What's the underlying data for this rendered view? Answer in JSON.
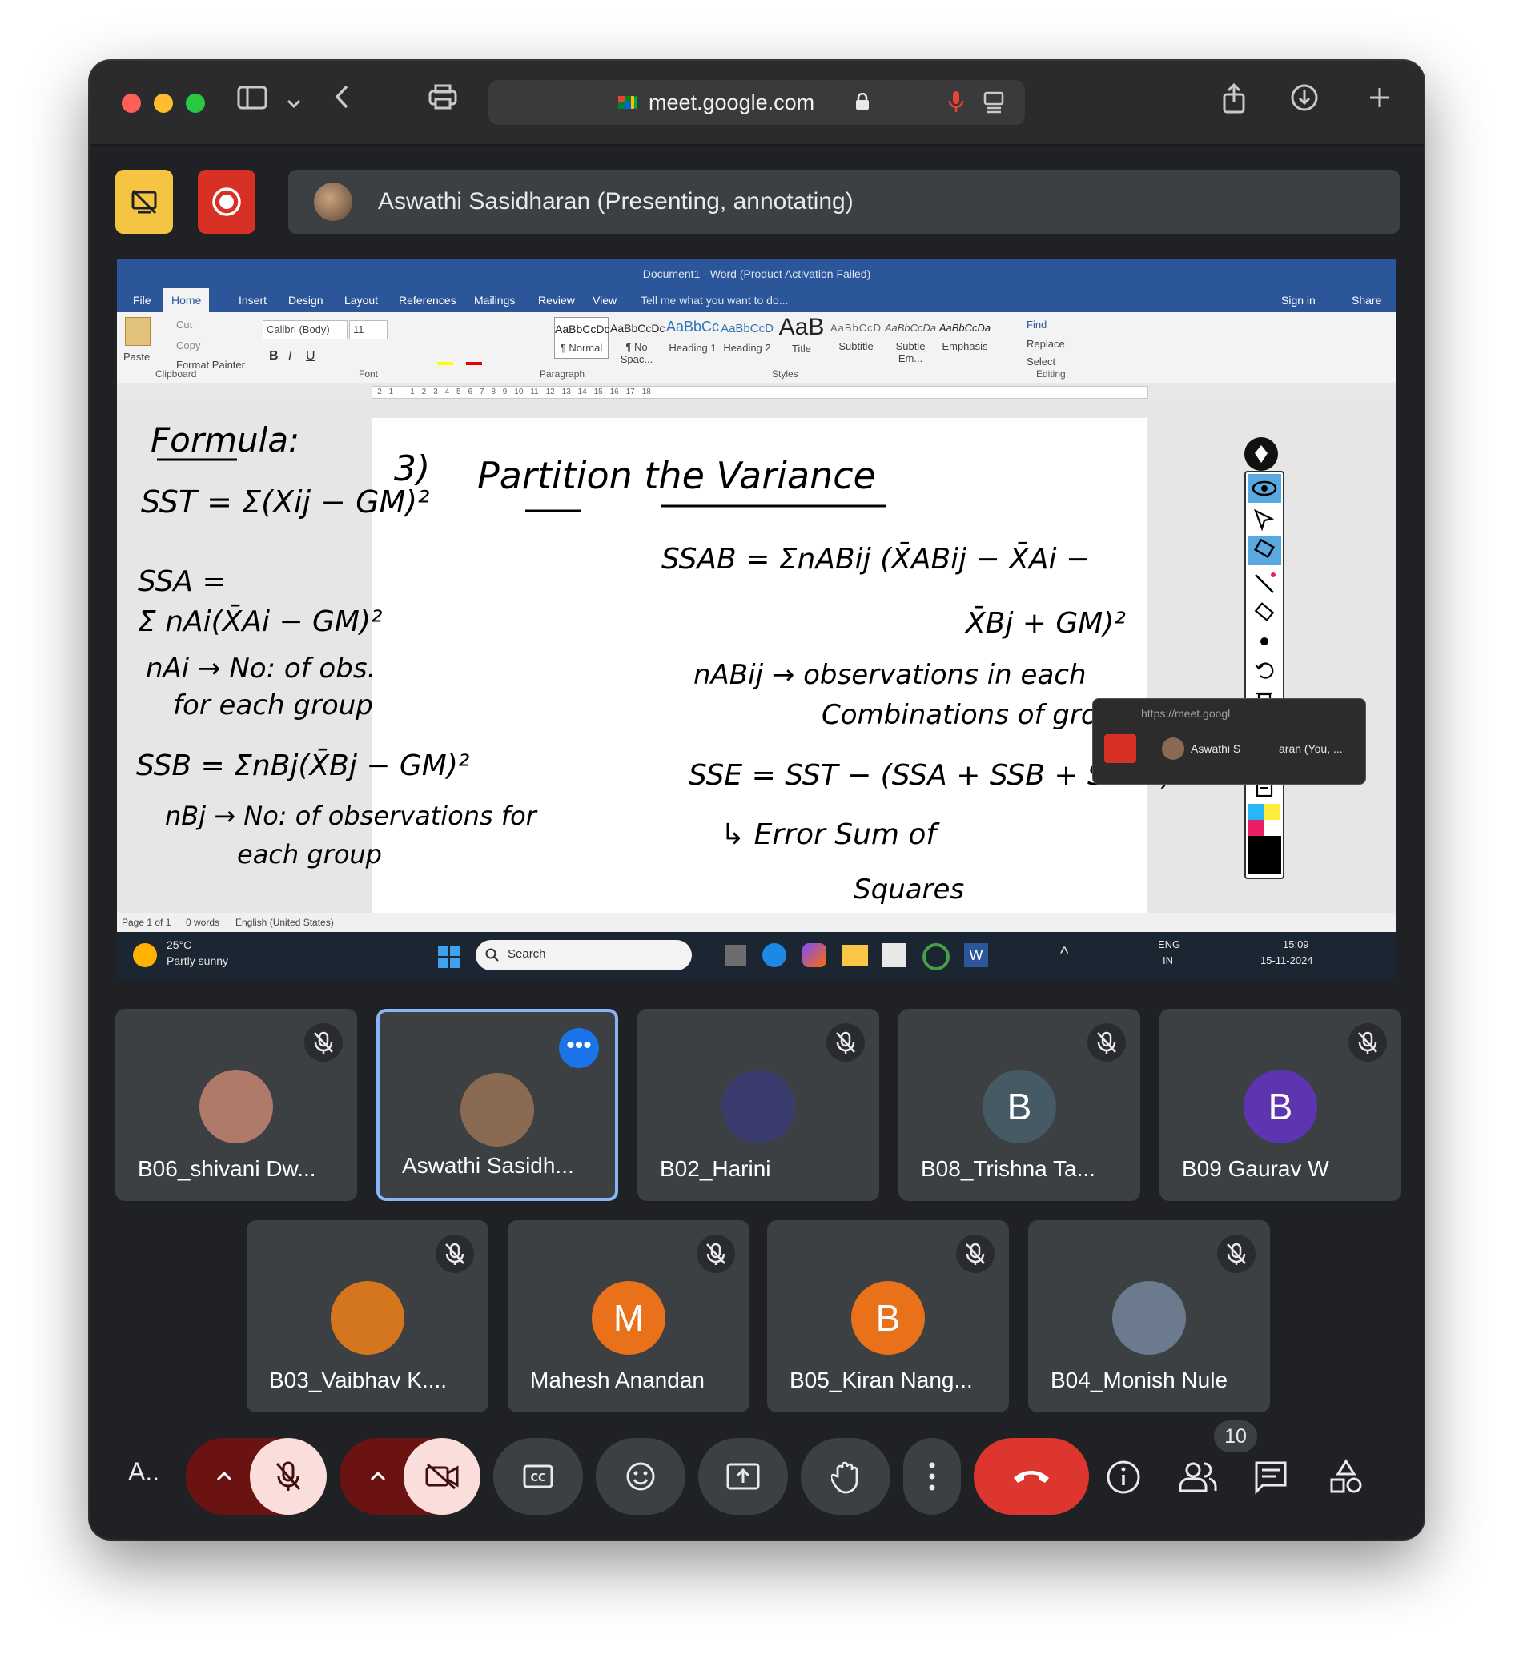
{
  "browser": {
    "url": "meet.google.com"
  },
  "meet": {
    "presenter_banner": "Aswathi Sasidharan (Presenting, annotating)"
  },
  "word": {
    "title": "Document1 - Word (Product Activation Failed)",
    "tabs": [
      "File",
      "Home",
      "Insert",
      "Design",
      "Layout",
      "References",
      "Mailings",
      "Review",
      "View"
    ],
    "tell_me": "Tell me what you want to do...",
    "sign_in": "Sign in",
    "share": "Share",
    "clipboard": {
      "paste": "Paste",
      "cut": "Cut",
      "copy": "Copy",
      "format_painter": "Format Painter",
      "group": "Clipboard"
    },
    "font": {
      "name": "Calibri (Body)",
      "size": "11",
      "group": "Font"
    },
    "paragraph_group": "Paragraph",
    "styles": [
      {
        "preview": "AaBbCcDc",
        "label": "¶ Normal"
      },
      {
        "preview": "AaBbCcDc",
        "label": "¶ No Spac..."
      },
      {
        "preview": "AaBbCc",
        "label": "Heading 1"
      },
      {
        "preview": "AaBbCcD",
        "label": "Heading 2"
      },
      {
        "preview": "AaB",
        "label": "Title"
      },
      {
        "preview": "AaBbCcD",
        "label": "Subtitle"
      },
      {
        "preview": "AaBbCcDa",
        "label": "Subtle Em..."
      },
      {
        "preview": "AaBbCcDa",
        "label": "Emphasis"
      }
    ],
    "styles_group": "Styles",
    "editing": {
      "find": "Find",
      "replace": "Replace",
      "select": "Select",
      "group": "Editing"
    },
    "ruler_marks": "· 2 · 1 · · · 1 · 2 · 3 · 4 · 5 · 6 · 7 · 8 · 9 · 10 · 11 · 12 · 13 · 14 · 15 · 16 · 17 · 18 ·",
    "status": {
      "page": "Page 1 of 1",
      "words": "0 words",
      "language": "English (United States)"
    }
  },
  "annotations": {
    "left": [
      "Formula:",
      "SST = Σ(Xij − GM)²",
      "SSA =",
      "Σ nAi(X̄Ai − GM)²",
      "nAi → No: of obs.",
      "for each group",
      "SSB = ΣnBj(X̄Bj − GM)²",
      "nBj → No: of observations for",
      "each group"
    ],
    "right": [
      "3)",
      "Partition the Variance",
      "SSAB = ΣnABij (X̄ABij − X̄Ai −",
      "X̄Bj + GM)²",
      "nABij → observations in each",
      "Combinations of groups",
      "SSE = SST − (SSA + SSB + SSAB)",
      "↳ Error Sum of",
      "Squares"
    ]
  },
  "mini_share": {
    "url": "https://meet.googl",
    "name": "Aswathi S",
    "name_suffix": "aran (You, ..."
  },
  "taskbar": {
    "weather_temp": "25°C",
    "weather_desc": "Partly sunny",
    "search": "Search",
    "lang_top": "ENG",
    "lang_bottom": "IN",
    "time": "15:09",
    "date": "15-11-2024"
  },
  "participants": [
    {
      "name": "B06_shivani Dw...",
      "initial": "",
      "color": "#b07a6a",
      "selected": false
    },
    {
      "name": "Aswathi Sasidh...",
      "initial": "",
      "color": "#8a6a52",
      "selected": true
    },
    {
      "name": "B02_Harini",
      "initial": "",
      "color": "#3b3c6e",
      "selected": false
    },
    {
      "name": "B08_Trishna Ta...",
      "initial": "B",
      "color": "#455a64",
      "selected": false
    },
    {
      "name": "B09 Gaurav W",
      "initial": "B",
      "color": "#5e35b1",
      "selected": false
    },
    {
      "name": "B03_Vaibhav K....",
      "initial": "",
      "color": "#d4761e",
      "selected": false
    },
    {
      "name": "Mahesh Anandan",
      "initial": "M",
      "color": "#e8711a",
      "selected": false
    },
    {
      "name": "B05_Kiran Nang...",
      "initial": "B",
      "color": "#e8711a",
      "selected": false
    },
    {
      "name": "B04_Monish Nule",
      "initial": "",
      "color": "#6b7a8c",
      "selected": false
    }
  ],
  "controls": {
    "self_label": "A..",
    "people_count": "10"
  },
  "colors": {
    "meet_bg": "#202124",
    "tile_bg": "#3c4043",
    "end_call": "#d93025",
    "word_blue": "#2b579a",
    "accent_blue": "#8ab4f8"
  }
}
